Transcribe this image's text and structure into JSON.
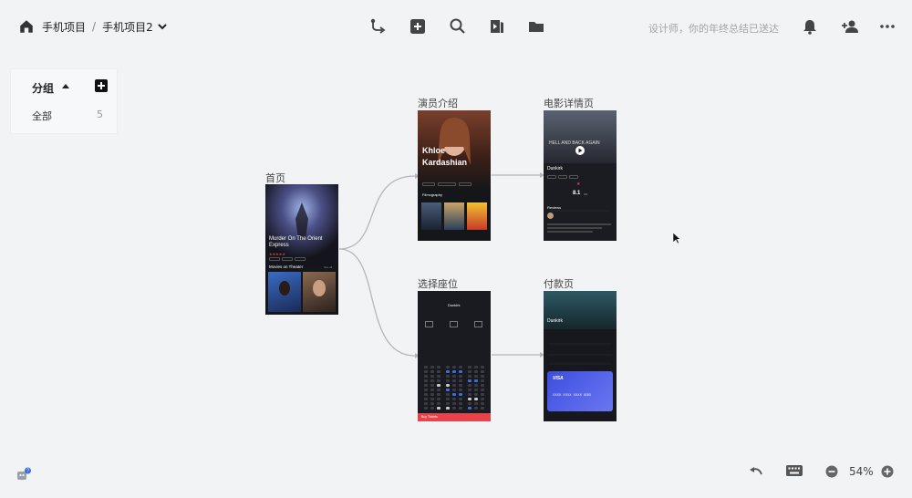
{
  "breadcrumb": {
    "root": "手机项目",
    "separator": "/",
    "current": "手机项目2"
  },
  "toolbar": {
    "tools": [
      "connect-flow-icon",
      "add-square-icon",
      "search-icon",
      "preview-icon",
      "folder-icon"
    ],
    "notice": "设计师，你的年终总结已送达"
  },
  "header_right": [
    "bell-icon",
    "add-member-icon",
    "more-icon"
  ],
  "group_panel": {
    "title": "分组",
    "items": [
      {
        "label": "全部",
        "count": "5"
      }
    ]
  },
  "boards": {
    "home": {
      "label": "首页",
      "movie_title": "Murder On The Orient Express",
      "section": "Movies on Theater",
      "see_all": "See all"
    },
    "actor": {
      "label": "演员介绍",
      "first_name": "Khloe",
      "last_name": "Kardashian",
      "subtitle": "Filmography"
    },
    "movie_detail": {
      "label": "电影详情页",
      "hero": "HELL AND BACK AGAIN",
      "title": "Dunkirk",
      "rating": "8.1",
      "rating_scale": "/10",
      "reviews": "Reviews"
    },
    "seat": {
      "label": "选择座位",
      "title": "Dunkirk",
      "cta": "Buy Tickets"
    },
    "payment": {
      "label": "付款页",
      "title": "Dunkirk",
      "card_brand": "VISA",
      "card_number": "XXXX  XXXX  XXXX  0283"
    }
  },
  "bottom": {
    "zoom": "54%"
  },
  "colors": {
    "accent_red": "#e8434b",
    "seat_selected": "#3b6fe0",
    "card_blue": "#4d5de8"
  }
}
